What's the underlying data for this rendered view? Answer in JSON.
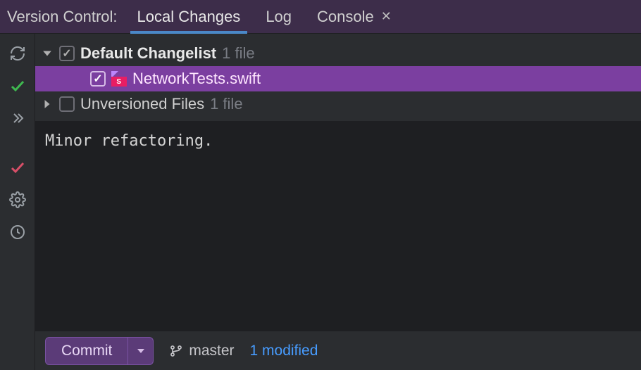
{
  "tabbar": {
    "title": "Version Control:",
    "tabs": [
      {
        "label": "Local Changes",
        "active": true,
        "closable": false
      },
      {
        "label": "Log",
        "active": false,
        "closable": false
      },
      {
        "label": "Console",
        "active": false,
        "closable": true
      }
    ]
  },
  "changelist": {
    "name": "Default Changelist",
    "count_label": "1 file",
    "file": {
      "name": "NetworkTests.swift",
      "icon_badge": "S"
    }
  },
  "unversioned": {
    "name": "Unversioned Files",
    "count_label": "1 file"
  },
  "commit_message": "Minor refactoring.",
  "footer": {
    "commit_label": "Commit",
    "branch": "master",
    "modified_label": "1 modified"
  }
}
